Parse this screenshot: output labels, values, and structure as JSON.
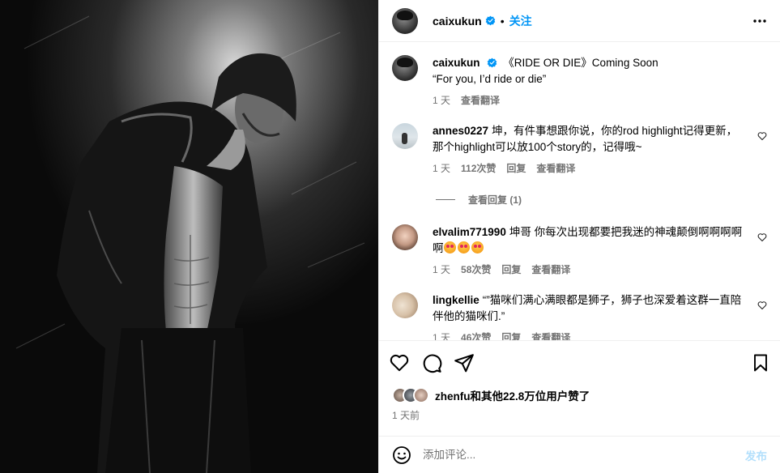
{
  "header": {
    "username": "caixukun",
    "follow_label": "关注",
    "separator": "•"
  },
  "caption": {
    "username": "caixukun",
    "text_line1": "《RIDE OR DIE》Coming Soon",
    "text_line2": "“For you, I’d ride or die”",
    "time": "1 天",
    "translate": "查看翻译"
  },
  "comments": [
    {
      "username": "annes0227",
      "text": "坤，有件事想跟你说，你的rod highlight记得更新，那个highlight可以放100个story的，记得哦~",
      "time": "1 天",
      "likes": "112次赞",
      "reply": "回复",
      "translate": "查看翻译",
      "view_replies": "查看回复 (1)"
    },
    {
      "username": "elvalim771990",
      "text": "坤哥 你每次出现都要把我迷的神魂颠倒啊啊啊啊",
      "time": "1 天",
      "likes": "58次赞",
      "reply": "回复",
      "translate": "查看翻译"
    },
    {
      "username": "lingkellie",
      "text": "“”猫咪们满心满眼都是狮子，狮子也深爱着这群一直陪伴他的猫咪们.”",
      "time": "1 天",
      "likes": "46次赞",
      "reply": "回复",
      "translate": "查看翻译"
    }
  ],
  "likes_summary": {
    "user": "zhenfu",
    "text": "和其他22.8万位用户赞了"
  },
  "post_time": "1 天前",
  "add_comment": {
    "placeholder": "添加评论...",
    "post_label": "发布"
  },
  "colors": {
    "accent": "#0095f6",
    "muted": "#737373",
    "post_disabled": "#b2dffc"
  }
}
